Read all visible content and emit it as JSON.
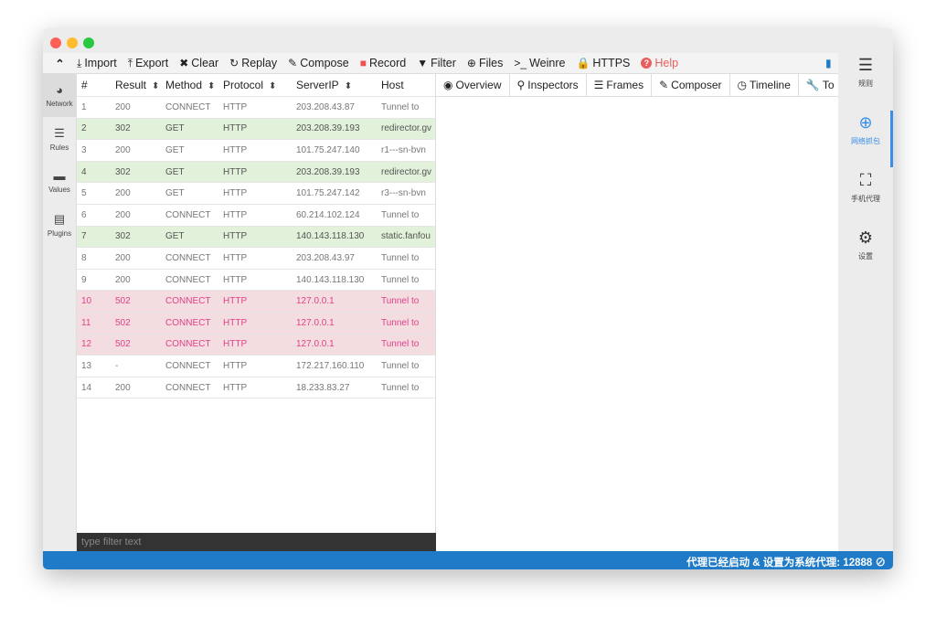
{
  "toolbar": {
    "items": [
      {
        "icon": "import-icon",
        "glyph": "⤓",
        "label": "Import"
      },
      {
        "icon": "export-icon",
        "glyph": "⤒",
        "label": "Export"
      },
      {
        "icon": "clear-icon",
        "glyph": "✖",
        "label": "Clear"
      },
      {
        "icon": "replay-icon",
        "glyph": "↻",
        "label": "Replay"
      },
      {
        "icon": "compose-icon",
        "glyph": "✎",
        "label": "Compose"
      },
      {
        "icon": "record-icon",
        "glyph": "■",
        "label": "Record"
      },
      {
        "icon": "filter-icon",
        "glyph": "▼",
        "label": "Filter"
      },
      {
        "icon": "files-icon",
        "glyph": "⊕",
        "label": "Files"
      },
      {
        "icon": "weinre-icon",
        "glyph": ">_",
        "label": "Weinre"
      },
      {
        "icon": "lock-icon",
        "glyph": "🔒",
        "label": "HTTPS"
      },
      {
        "icon": "help-icon",
        "glyph": "?",
        "label": "Help"
      }
    ]
  },
  "leftnav": [
    {
      "label": "Network",
      "glyph": "◕"
    },
    {
      "label": "Rules",
      "glyph": "☰"
    },
    {
      "label": "Values",
      "glyph": "▬"
    },
    {
      "label": "Plugins",
      "glyph": "▤"
    }
  ],
  "table": {
    "headers": [
      "#",
      "Result",
      "Method",
      "Protocol",
      "ServerIP",
      "Host"
    ],
    "rows": [
      [
        "1",
        "200",
        "CONNECT",
        "HTTP",
        "203.208.43.87",
        "Tunnel to"
      ],
      [
        "2",
        "302",
        "GET",
        "HTTP",
        "203.208.39.193",
        "redirector.gv"
      ],
      [
        "3",
        "200",
        "GET",
        "HTTP",
        "101.75.247.140",
        "r1---sn-bvn"
      ],
      [
        "4",
        "302",
        "GET",
        "HTTP",
        "203.208.39.193",
        "redirector.gv"
      ],
      [
        "5",
        "200",
        "GET",
        "HTTP",
        "101.75.247.142",
        "r3---sn-bvn"
      ],
      [
        "6",
        "200",
        "CONNECT",
        "HTTP",
        "60.214.102.124",
        "Tunnel to"
      ],
      [
        "7",
        "302",
        "GET",
        "HTTP",
        "140.143.118.130",
        "static.fanfou"
      ],
      [
        "8",
        "200",
        "CONNECT",
        "HTTP",
        "203.208.43.97",
        "Tunnel to"
      ],
      [
        "9",
        "200",
        "CONNECT",
        "HTTP",
        "140.143.118.130",
        "Tunnel to"
      ],
      [
        "10",
        "502",
        "CONNECT",
        "HTTP",
        "127.0.0.1",
        "Tunnel to"
      ],
      [
        "11",
        "502",
        "CONNECT",
        "HTTP",
        "127.0.0.1",
        "Tunnel to"
      ],
      [
        "12",
        "502",
        "CONNECT",
        "HTTP",
        "127.0.0.1",
        "Tunnel to"
      ],
      [
        "13",
        "-",
        "CONNECT",
        "HTTP",
        "172.217.160.110",
        "Tunnel to"
      ],
      [
        "14",
        "200",
        "CONNECT",
        "HTTP",
        "18.233.83.27",
        "Tunnel to"
      ]
    ]
  },
  "filter": {
    "placeholder": "type filter text"
  },
  "tabs": [
    {
      "glyph": "◉",
      "label": "Overview"
    },
    {
      "glyph": "⚲",
      "label": "Inspectors"
    },
    {
      "glyph": "☰",
      "label": "Frames"
    },
    {
      "glyph": "✎",
      "label": "Composer"
    },
    {
      "glyph": "◷",
      "label": "Timeline"
    },
    {
      "glyph": "🔧",
      "label": "To"
    }
  ],
  "rightnav": [
    {
      "label": "规则",
      "glyph": "☰"
    },
    {
      "label": "网络抓包",
      "glyph": "⊕",
      "active": true
    },
    {
      "label": "手机代理",
      "glyph": "⛶"
    },
    {
      "label": "设置",
      "glyph": "⚙"
    }
  ],
  "status": "代理已经启动 & 设置为系统代理: 12888 ⊘",
  "colors": {
    "status_bar": "#1f7bc8",
    "redirect_row": "#e2f1d9",
    "error_row": "#f4dde1",
    "error_text": "#e0408a"
  }
}
